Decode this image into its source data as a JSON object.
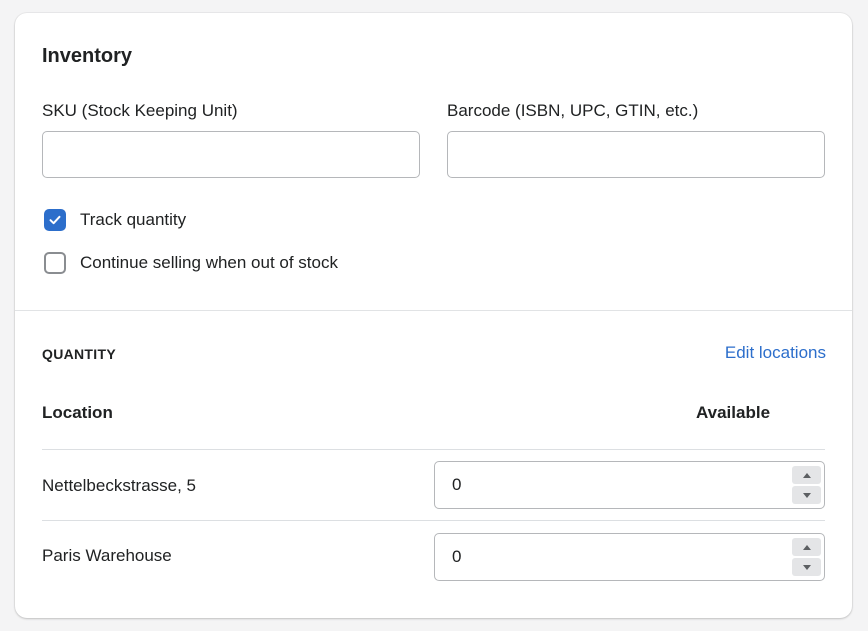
{
  "card": {
    "title": "Inventory",
    "sku": {
      "label": "SKU (Stock Keeping Unit)",
      "value": "",
      "placeholder": ""
    },
    "barcode": {
      "label": "Barcode (ISBN, UPC, GTIN, etc.)",
      "value": "",
      "placeholder": ""
    },
    "track_quantity": {
      "label": "Track quantity",
      "checked": true
    },
    "continue_selling": {
      "label": "Continue selling when out of stock",
      "checked": false
    }
  },
  "quantity": {
    "heading": "QUANTITY",
    "edit_link": "Edit locations",
    "columns": {
      "location": "Location",
      "available": "Available"
    },
    "rows": [
      {
        "location": "Nettelbeckstrasse, 5",
        "available": "0"
      },
      {
        "location": "Paris Warehouse",
        "available": "0"
      }
    ]
  },
  "colors": {
    "accent": "#2c6ecb",
    "background": "#f4f4f5"
  }
}
